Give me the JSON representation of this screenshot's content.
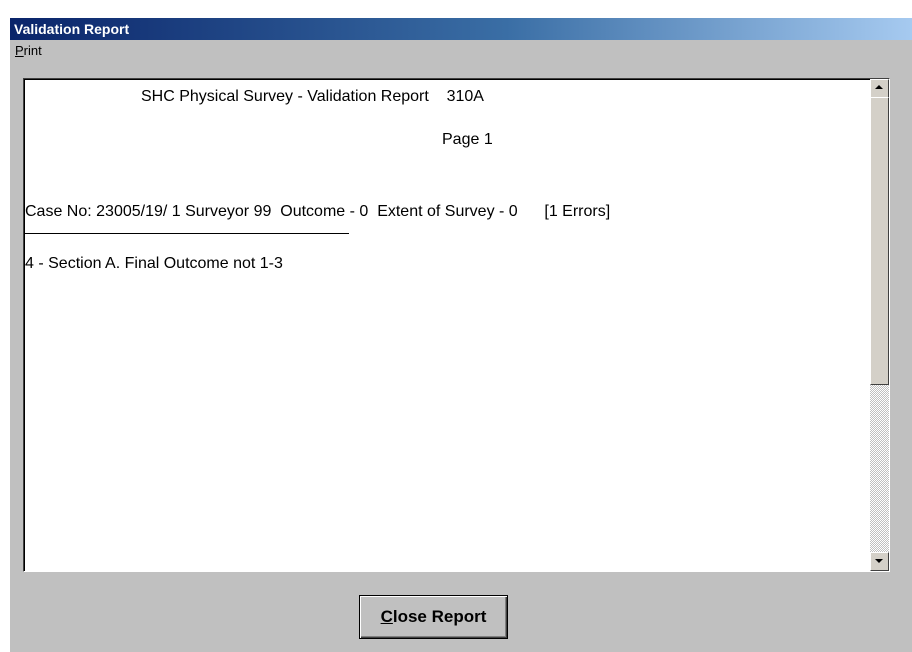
{
  "window": {
    "title": "Validation Report"
  },
  "menu": {
    "print_mnemonic": "P",
    "print_rest": "rint"
  },
  "report": {
    "header": "SHC Physical Survey - Validation Report    310A",
    "page": "Page 1",
    "case_line": "Case No: 23005/19/ 1 Surveyor 99  Outcome - 0  Extent of Survey - 0      [1 Errors]",
    "error_line": "4 - Section A. Final Outcome not 1-3"
  },
  "buttons": {
    "close_mnemonic": "C",
    "close_rest": "lose Report"
  },
  "scrollbar": {
    "up_icon": "arrow-up-icon",
    "down_icon": "arrow-down-icon"
  },
  "colors": {
    "titlebar_start": "#0a246a",
    "titlebar_end": "#a6caf0",
    "window_bg": "#c0c0c0"
  }
}
